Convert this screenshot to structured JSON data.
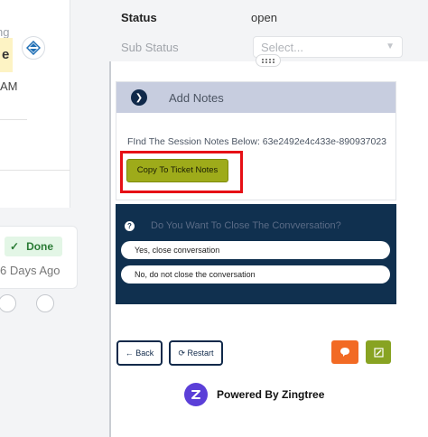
{
  "left_panel": {
    "fragment_top": "ng",
    "fragment_badge": "e",
    "fragment_time": "AM",
    "done_label": "Done",
    "days_ago": "6 Days Ago"
  },
  "status": {
    "status_label": "Status",
    "status_value": "open",
    "substatus_label": "Sub Status",
    "substatus_placeholder": "Select..."
  },
  "notes": {
    "header_title": "Add Notes",
    "session_text": "FInd The Session Notes Below: 63e2492e4c433e-890937023",
    "copy_button": "Copy To Ticket Notes"
  },
  "close_conversation": {
    "question": "Do You Want To Close The Convversation?",
    "option_yes": "Yes, close conversation",
    "option_no": "No, do not close the conversation"
  },
  "nav": {
    "back_label": "Back",
    "restart_label": "Restart"
  },
  "footer": {
    "powered_by": "Powered By Zingtree"
  },
  "colors": {
    "navy": "#10304f",
    "copy_button": "#9eab1a",
    "highlight": "#e60f15",
    "chat_button": "#f26a24",
    "edit_button": "#88a322",
    "brand_purple": "#5b3fd8"
  }
}
